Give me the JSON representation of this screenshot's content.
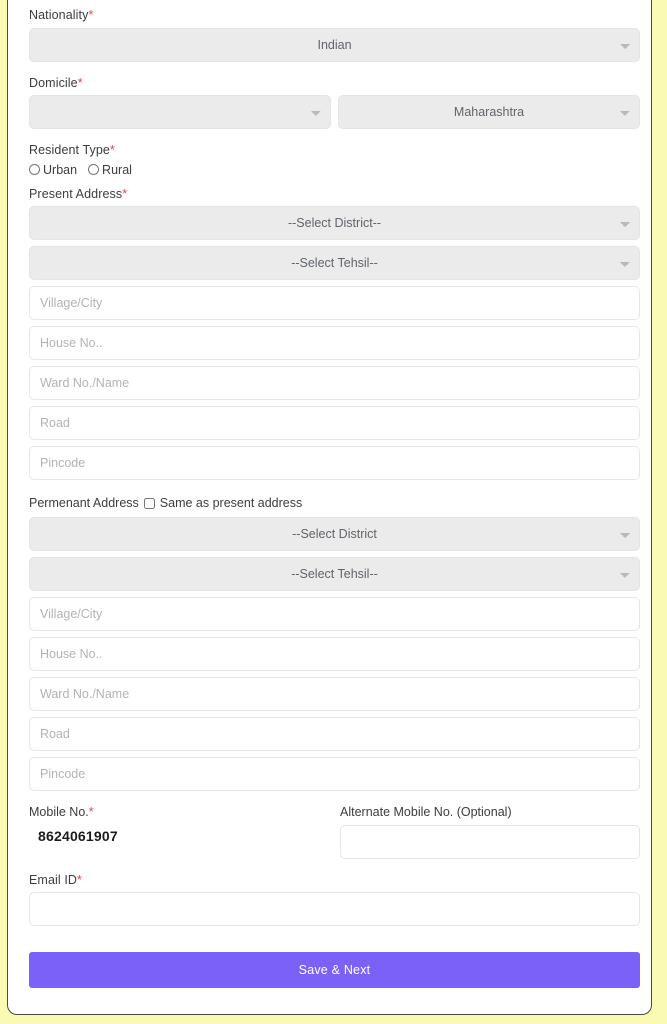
{
  "form": {
    "nationality": {
      "label": "Nationality",
      "required": true,
      "value": "Indian"
    },
    "domicile": {
      "label": "Domicile",
      "required": true,
      "country_value": "",
      "state_value": "Maharashtra"
    },
    "resident_type": {
      "label": "Resident Type",
      "required": true,
      "options": [
        {
          "label": "Urban",
          "selected": false
        },
        {
          "label": "Rural",
          "selected": false
        }
      ]
    },
    "present_address": {
      "label": "Present Address",
      "required": true,
      "district_value": "--Select District--",
      "tehsil_value": "--Select Tehsil--",
      "village_placeholder": "Village/City",
      "village_value": "",
      "house_placeholder": "House No..",
      "house_value": "",
      "ward_placeholder": "Ward No./Name",
      "ward_value": "",
      "road_placeholder": "Road",
      "road_value": "",
      "pincode_placeholder": "Pincode",
      "pincode_value": ""
    },
    "permanent_address": {
      "label": "Permenant Address",
      "same_as_present_label": "Same as present address",
      "same_as_present_checked": false,
      "district_value": "--Select District",
      "tehsil_value": "--Select Tehsil--",
      "village_placeholder": "Village/City",
      "village_value": "",
      "house_placeholder": "House No..",
      "house_value": "",
      "ward_placeholder": "Ward No./Name",
      "ward_value": "",
      "road_placeholder": "Road",
      "road_value": "",
      "pincode_placeholder": "Pincode",
      "pincode_value": ""
    },
    "mobile": {
      "label": "Mobile No.",
      "required": true,
      "value": "8624061907"
    },
    "alternate_mobile": {
      "label": "Alternate Mobile No. (Optional)",
      "required": false,
      "value": "",
      "placeholder": ""
    },
    "email": {
      "label": "Email ID",
      "required": true,
      "value": "",
      "placeholder": ""
    },
    "submit": {
      "label": "Save & Next"
    }
  },
  "theme": {
    "page_background": "#fafab4",
    "card_background": "#ffffff",
    "accent": "#7b61f8",
    "required_star": "#e0474c",
    "disabled_field": "#ebebeb"
  }
}
